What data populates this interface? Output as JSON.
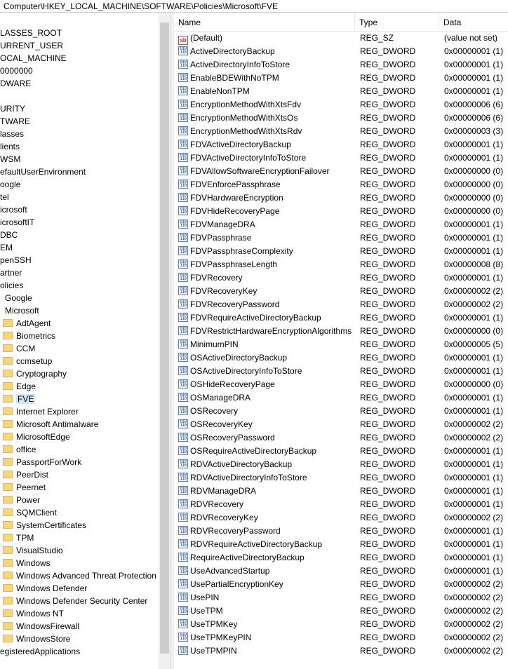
{
  "address_bar": "Computer\\HKEY_LOCAL_MACHINE\\SOFTWARE\\Policies\\Microsoft\\FVE",
  "tree": [
    {
      "label": "LASSES_ROOT",
      "x": 0,
      "folder": false
    },
    {
      "label": "URRENT_USER",
      "x": 0,
      "folder": false
    },
    {
      "label": "OCAL_MACHINE",
      "x": 0,
      "folder": false
    },
    {
      "label": "0000000",
      "x": 0,
      "folder": false
    },
    {
      "label": "DWARE",
      "x": 0,
      "folder": false
    },
    {
      "label": "",
      "x": 0,
      "folder": false
    },
    {
      "label": "URITY",
      "x": 0,
      "folder": false
    },
    {
      "label": "TWARE",
      "x": 0,
      "folder": false
    },
    {
      "label": "lasses",
      "x": 0,
      "folder": false
    },
    {
      "label": "lients",
      "x": 0,
      "folder": false
    },
    {
      "label": "WSM",
      "x": 0,
      "folder": false
    },
    {
      "label": "efaultUserEnvironment",
      "x": 0,
      "folder": false
    },
    {
      "label": "oogle",
      "x": 0,
      "folder": false
    },
    {
      "label": "tel",
      "x": 0,
      "folder": false
    },
    {
      "label": "icrosoft",
      "x": 0,
      "folder": false
    },
    {
      "label": "icrosoftIT",
      "x": 0,
      "folder": false
    },
    {
      "label": "DBC",
      "x": 0,
      "folder": false
    },
    {
      "label": "EM",
      "x": 0,
      "folder": false
    },
    {
      "label": "penSSH",
      "x": 0,
      "folder": false
    },
    {
      "label": "artner",
      "x": 0,
      "folder": false
    },
    {
      "label": "olicies",
      "x": 0,
      "folder": false
    },
    {
      "label": "Google",
      "x": 7,
      "folder": false
    },
    {
      "label": "Microsoft",
      "x": 7,
      "folder": false
    },
    {
      "label": "AdtAgent",
      "x": 4,
      "folder": true
    },
    {
      "label": "Biometrics",
      "x": 4,
      "folder": true
    },
    {
      "label": "CCM",
      "x": 4,
      "folder": true
    },
    {
      "label": "ccmsetup",
      "x": 4,
      "folder": true
    },
    {
      "label": "Cryptography",
      "x": 4,
      "folder": true
    },
    {
      "label": "Edge",
      "x": 4,
      "folder": true
    },
    {
      "label": "FVE",
      "x": 4,
      "folder": true,
      "selected": true
    },
    {
      "label": "Internet Explorer",
      "x": 4,
      "folder": true
    },
    {
      "label": "Microsoft Antimalware",
      "x": 4,
      "folder": true
    },
    {
      "label": "MicrosoftEdge",
      "x": 4,
      "folder": true
    },
    {
      "label": "office",
      "x": 4,
      "folder": true
    },
    {
      "label": "PassportForWork",
      "x": 4,
      "folder": true
    },
    {
      "label": "PeerDist",
      "x": 4,
      "folder": true
    },
    {
      "label": "Peernet",
      "x": 4,
      "folder": true
    },
    {
      "label": "Power",
      "x": 4,
      "folder": true
    },
    {
      "label": "SQMClient",
      "x": 4,
      "folder": true
    },
    {
      "label": "SystemCertificates",
      "x": 4,
      "folder": true
    },
    {
      "label": "TPM",
      "x": 4,
      "folder": true
    },
    {
      "label": "VisualStudio",
      "x": 4,
      "folder": true
    },
    {
      "label": "Windows",
      "x": 4,
      "folder": true
    },
    {
      "label": "Windows Advanced Threat Protection",
      "x": 4,
      "folder": true
    },
    {
      "label": "Windows Defender",
      "x": 4,
      "folder": true
    },
    {
      "label": "Windows Defender Security Center",
      "x": 4,
      "folder": true
    },
    {
      "label": "Windows NT",
      "x": 4,
      "folder": true
    },
    {
      "label": "WindowsFirewall",
      "x": 4,
      "folder": true
    },
    {
      "label": "WindowsStore",
      "x": 4,
      "folder": true
    },
    {
      "label": "egisteredApplications",
      "x": 0,
      "folder": false
    }
  ],
  "columns": {
    "name": "Name",
    "type": "Type",
    "data": "Data"
  },
  "values": [
    {
      "name": "(Default)",
      "type": "REG_SZ",
      "data": "(value not set)",
      "icon": "string-value-icon"
    },
    {
      "name": "ActiveDirectoryBackup",
      "type": "REG_DWORD",
      "data": "0x00000001 (1)",
      "icon": "binary-value-icon"
    },
    {
      "name": "ActiveDirectoryInfoToStore",
      "type": "REG_DWORD",
      "data": "0x00000001 (1)",
      "icon": "binary-value-icon"
    },
    {
      "name": "EnableBDEWithNoTPM",
      "type": "REG_DWORD",
      "data": "0x00000001 (1)",
      "icon": "binary-value-icon"
    },
    {
      "name": "EnableNonTPM",
      "type": "REG_DWORD",
      "data": "0x00000001 (1)",
      "icon": "binary-value-icon"
    },
    {
      "name": "EncryptionMethodWithXtsFdv",
      "type": "REG_DWORD",
      "data": "0x00000006 (6)",
      "icon": "binary-value-icon"
    },
    {
      "name": "EncryptionMethodWithXtsOs",
      "type": "REG_DWORD",
      "data": "0x00000006 (6)",
      "icon": "binary-value-icon"
    },
    {
      "name": "EncryptionMethodWithXtsRdv",
      "type": "REG_DWORD",
      "data": "0x00000003 (3)",
      "icon": "binary-value-icon"
    },
    {
      "name": "FDVActiveDirectoryBackup",
      "type": "REG_DWORD",
      "data": "0x00000001 (1)",
      "icon": "binary-value-icon"
    },
    {
      "name": "FDVActiveDirectoryInfoToStore",
      "type": "REG_DWORD",
      "data": "0x00000001 (1)",
      "icon": "binary-value-icon"
    },
    {
      "name": "FDVAllowSoftwareEncryptionFailover",
      "type": "REG_DWORD",
      "data": "0x00000000 (0)",
      "icon": "binary-value-icon"
    },
    {
      "name": "FDVEnforcePassphrase",
      "type": "REG_DWORD",
      "data": "0x00000000 (0)",
      "icon": "binary-value-icon"
    },
    {
      "name": "FDVHardwareEncryption",
      "type": "REG_DWORD",
      "data": "0x00000000 (0)",
      "icon": "binary-value-icon"
    },
    {
      "name": "FDVHideRecoveryPage",
      "type": "REG_DWORD",
      "data": "0x00000000 (0)",
      "icon": "binary-value-icon"
    },
    {
      "name": "FDVManageDRA",
      "type": "REG_DWORD",
      "data": "0x00000001 (1)",
      "icon": "binary-value-icon"
    },
    {
      "name": "FDVPassphrase",
      "type": "REG_DWORD",
      "data": "0x00000001 (1)",
      "icon": "binary-value-icon"
    },
    {
      "name": "FDVPassphraseComplexity",
      "type": "REG_DWORD",
      "data": "0x00000001 (1)",
      "icon": "binary-value-icon"
    },
    {
      "name": "FDVPassphraseLength",
      "type": "REG_DWORD",
      "data": "0x00000008 (8)",
      "icon": "binary-value-icon"
    },
    {
      "name": "FDVRecovery",
      "type": "REG_DWORD",
      "data": "0x00000001 (1)",
      "icon": "binary-value-icon"
    },
    {
      "name": "FDVRecoveryKey",
      "type": "REG_DWORD",
      "data": "0x00000002 (2)",
      "icon": "binary-value-icon"
    },
    {
      "name": "FDVRecoveryPassword",
      "type": "REG_DWORD",
      "data": "0x00000002 (2)",
      "icon": "binary-value-icon"
    },
    {
      "name": "FDVRequireActiveDirectoryBackup",
      "type": "REG_DWORD",
      "data": "0x00000001 (1)",
      "icon": "binary-value-icon"
    },
    {
      "name": "FDVRestrictHardwareEncryptionAlgorithms",
      "type": "REG_DWORD",
      "data": "0x00000000 (0)",
      "icon": "binary-value-icon"
    },
    {
      "name": "MinimumPIN",
      "type": "REG_DWORD",
      "data": "0x00000005 (5)",
      "icon": "binary-value-icon"
    },
    {
      "name": "OSActiveDirectoryBackup",
      "type": "REG_DWORD",
      "data": "0x00000001 (1)",
      "icon": "binary-value-icon"
    },
    {
      "name": "OSActiveDirectoryInfoToStore",
      "type": "REG_DWORD",
      "data": "0x00000001 (1)",
      "icon": "binary-value-icon"
    },
    {
      "name": "OSHideRecoveryPage",
      "type": "REG_DWORD",
      "data": "0x00000000 (0)",
      "icon": "binary-value-icon"
    },
    {
      "name": "OSManageDRA",
      "type": "REG_DWORD",
      "data": "0x00000001 (1)",
      "icon": "binary-value-icon"
    },
    {
      "name": "OSRecovery",
      "type": "REG_DWORD",
      "data": "0x00000001 (1)",
      "icon": "binary-value-icon"
    },
    {
      "name": "OSRecoveryKey",
      "type": "REG_DWORD",
      "data": "0x00000002 (2)",
      "icon": "binary-value-icon"
    },
    {
      "name": "OSRecoveryPassword",
      "type": "REG_DWORD",
      "data": "0x00000002 (2)",
      "icon": "binary-value-icon"
    },
    {
      "name": "OSRequireActiveDirectoryBackup",
      "type": "REG_DWORD",
      "data": "0x00000001 (1)",
      "icon": "binary-value-icon"
    },
    {
      "name": "RDVActiveDirectoryBackup",
      "type": "REG_DWORD",
      "data": "0x00000001 (1)",
      "icon": "binary-value-icon"
    },
    {
      "name": "RDVActiveDirectoryInfoToStore",
      "type": "REG_DWORD",
      "data": "0x00000001 (1)",
      "icon": "binary-value-icon"
    },
    {
      "name": "RDVManageDRA",
      "type": "REG_DWORD",
      "data": "0x00000001 (1)",
      "icon": "binary-value-icon"
    },
    {
      "name": "RDVRecovery",
      "type": "REG_DWORD",
      "data": "0x00000001 (1)",
      "icon": "binary-value-icon"
    },
    {
      "name": "RDVRecoveryKey",
      "type": "REG_DWORD",
      "data": "0x00000002 (2)",
      "icon": "binary-value-icon"
    },
    {
      "name": "RDVRecoveryPassword",
      "type": "REG_DWORD",
      "data": "0x00000001 (1)",
      "icon": "binary-value-icon"
    },
    {
      "name": "RDVRequireActiveDirectoryBackup",
      "type": "REG_DWORD",
      "data": "0x00000001 (1)",
      "icon": "binary-value-icon"
    },
    {
      "name": "RequireActiveDirectoryBackup",
      "type": "REG_DWORD",
      "data": "0x00000001 (1)",
      "icon": "binary-value-icon"
    },
    {
      "name": "UseAdvancedStartup",
      "type": "REG_DWORD",
      "data": "0x00000001 (1)",
      "icon": "binary-value-icon"
    },
    {
      "name": "UsePartialEncryptionKey",
      "type": "REG_DWORD",
      "data": "0x00000002 (2)",
      "icon": "binary-value-icon"
    },
    {
      "name": "UsePIN",
      "type": "REG_DWORD",
      "data": "0x00000002 (2)",
      "icon": "binary-value-icon"
    },
    {
      "name": "UseTPM",
      "type": "REG_DWORD",
      "data": "0x00000002 (2)",
      "icon": "binary-value-icon"
    },
    {
      "name": "UseTPMKey",
      "type": "REG_DWORD",
      "data": "0x00000002 (2)",
      "icon": "binary-value-icon"
    },
    {
      "name": "UseTPMKeyPIN",
      "type": "REG_DWORD",
      "data": "0x00000002 (2)",
      "icon": "binary-value-icon"
    },
    {
      "name": "UseTPMPIN",
      "type": "REG_DWORD",
      "data": "0x00000002 (2)",
      "icon": "binary-value-icon"
    }
  ]
}
